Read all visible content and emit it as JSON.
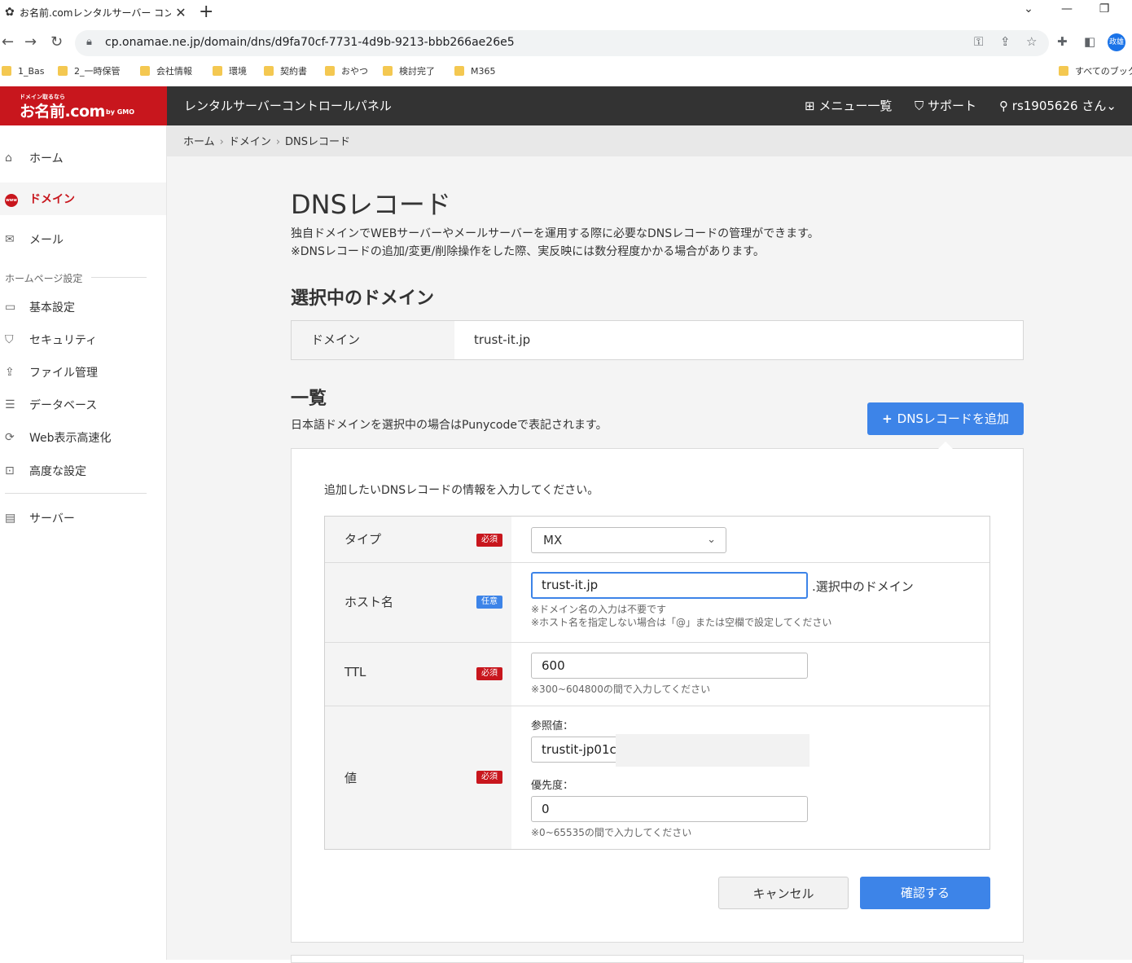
{
  "browser": {
    "tab_title": "お名前.comレンタルサーバー コントロー",
    "url": "cp.onamae.ne.jp/domain/dns/d9fa70cf-7731-4d9b-9213-bbb266ae26e5",
    "profile_label": "政雄",
    "bookmarks": [
      "1_Bas",
      "2_一時保管",
      "会社情報",
      "環境",
      "契約書",
      "おやつ",
      "検討完了",
      "M365"
    ],
    "bookmarks_right": "すべてのブック"
  },
  "header": {
    "logo_small": "ドメイン取るなら",
    "logo_main": "お名前.com",
    "logo_gmo": "by GMO",
    "app_title": "レンタルサーバーコントロールパネル",
    "menu_label": "メニュー一覧",
    "support_label": "サポート",
    "user_label": "rs1905626 さん"
  },
  "sidebar": {
    "items": [
      {
        "label": "ホーム",
        "icon": "home-icon"
      },
      {
        "label": "ドメイン",
        "icon": "www-icon"
      },
      {
        "label": "メール",
        "icon": "mail-icon"
      }
    ],
    "section_heading": "ホームページ設定",
    "section_items": [
      {
        "label": "基本設定",
        "icon": "monitor-icon"
      },
      {
        "label": "セキュリティ",
        "icon": "shield-icon"
      },
      {
        "label": "ファイル管理",
        "icon": "upload-icon"
      },
      {
        "label": "データベース",
        "icon": "database-icon"
      },
      {
        "label": "Web表示高速化",
        "icon": "speed-icon"
      },
      {
        "label": "高度な設定",
        "icon": "settings-monitor-icon"
      }
    ],
    "server_label": "サーバー"
  },
  "breadcrumb": [
    "ホーム",
    "ドメイン",
    "DNSレコード"
  ],
  "page": {
    "title": "DNSレコード",
    "desc1": "独自ドメインでWEBサーバーやメールサーバーを運用する際に必要なDNSレコードの管理ができます。",
    "desc2": "※DNSレコードの追加/変更/削除操作をした際、実反映には数分程度かかる場合があります。",
    "selected_heading": "選択中のドメイン",
    "domain_label": "ドメイン",
    "domain_value": "trust-it.jp",
    "list_heading": "一覧",
    "list_desc": "日本語ドメインを選択中の場合はPunycodeで表記されます。",
    "add_button": "DNSレコードを追加"
  },
  "form": {
    "intro": "追加したいDNSレコードの情報を入力してください。",
    "required_badge": "必須",
    "optional_badge": "任意",
    "type_label": "タイプ",
    "type_value": "MX",
    "host_label": "ホスト名",
    "host_value": "trust-it.jp",
    "host_suffix": ".選択中のドメイン",
    "host_hint1": "※ドメイン名の入力は不要です",
    "host_hint2": "※ホスト名を指定しない場合は「@」または空欄で設定してください",
    "ttl_label": "TTL",
    "ttl_value": "600",
    "ttl_hint": "※300~604800の間で入力してください",
    "value_label": "値",
    "ref_label": "参照値：",
    "ref_value": "trustit-jp01c",
    "priority_label": "優先度：",
    "priority_value": "0",
    "priority_hint": "※0~65535の間で入力してください",
    "cancel_button": "キャンセル",
    "confirm_button": "確認する"
  },
  "colors": {
    "brand_red": "#c8161d",
    "header_dark": "#333333",
    "accent_blue": "#3d84e8"
  }
}
